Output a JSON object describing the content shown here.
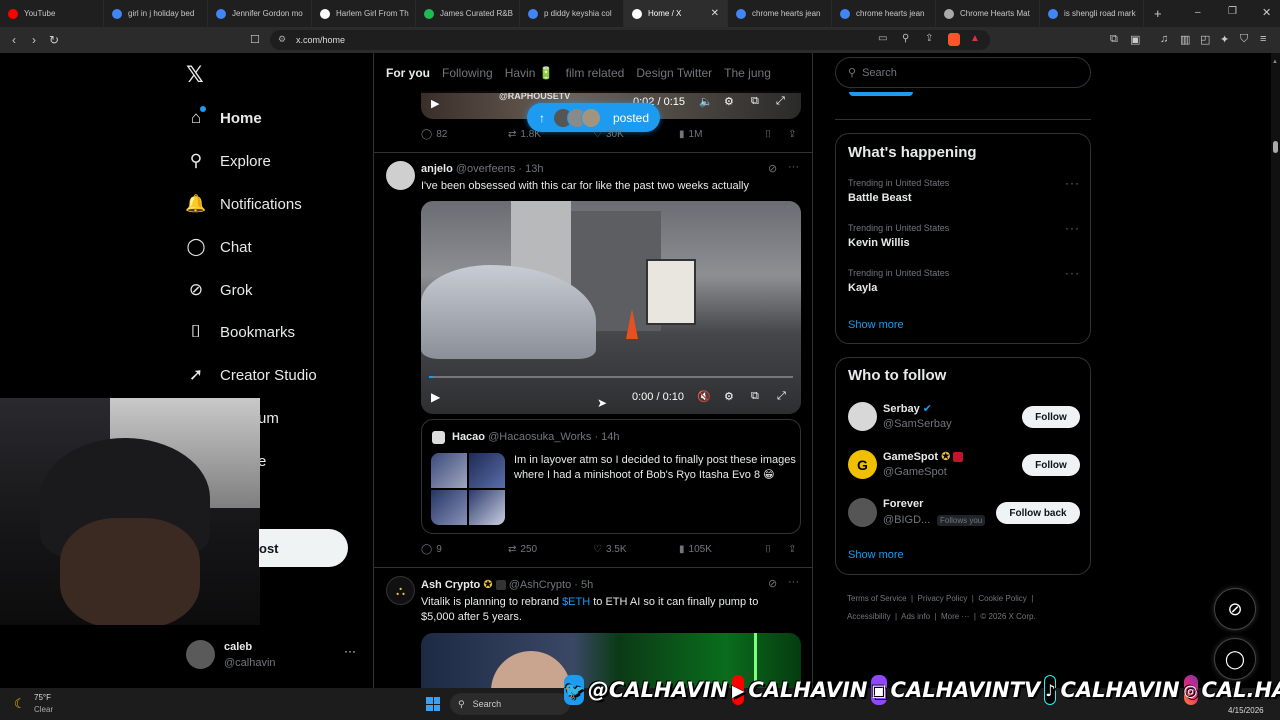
{
  "browser": {
    "tabs": [
      {
        "label": "YouTube",
        "color": "#ff0000",
        "active": false
      },
      {
        "label": "girl in j holiday bed",
        "color": "#4285f4",
        "active": false
      },
      {
        "label": "Jennifer Gordon mo",
        "color": "#4285f4",
        "active": false
      },
      {
        "label": "Harlem Girl From Th",
        "color": "#ffffff",
        "active": false
      },
      {
        "label": "James Curated R&B",
        "color": "#1db954",
        "active": false
      },
      {
        "label": "p diddy keyshia col",
        "color": "#4285f4",
        "active": false
      },
      {
        "label": "Home / X",
        "color": "#ffffff",
        "active": true
      },
      {
        "label": "chrome hearts jean",
        "color": "#4285f4",
        "active": false
      },
      {
        "label": "chrome hearts jean",
        "color": "#4285f4",
        "active": false
      },
      {
        "label": "Chrome Hearts Mat",
        "color": "#aaaaaa",
        "active": false
      },
      {
        "label": "is shengli road mark",
        "color": "#4285f4",
        "active": false
      }
    ],
    "url": "x.com/home"
  },
  "nav": {
    "items": [
      {
        "label": "Home",
        "icon": "home-icon",
        "glyph": "⌂",
        "bold": true
      },
      {
        "label": "Explore",
        "icon": "search-icon",
        "glyph": "⚲",
        "bold": false
      },
      {
        "label": "Notifications",
        "icon": "bell-icon",
        "glyph": "🔔",
        "bold": false
      },
      {
        "label": "Chat",
        "icon": "chat-icon",
        "glyph": "◯",
        "bold": false
      },
      {
        "label": "Grok",
        "icon": "grok-icon",
        "glyph": "⊘",
        "bold": false
      },
      {
        "label": "Bookmarks",
        "icon": "bookmark-icon",
        "glyph": "⌷",
        "bold": false
      },
      {
        "label": "Creator Studio",
        "icon": "rocket-icon",
        "glyph": "➚",
        "bold": false
      },
      {
        "label": "um",
        "icon": "premium-icon",
        "glyph": "",
        "bold": false
      },
      {
        "label": "e",
        "icon": "profile-icon",
        "glyph": "",
        "bold": false
      }
    ],
    "post_label": "ost",
    "account": {
      "name": "caleb",
      "handle": "@calhavin"
    }
  },
  "feed": {
    "tabs": [
      "For you",
      "Following",
      "Havin 🔋",
      "film related",
      "Design Twitter",
      "The jung"
    ],
    "top_post": {
      "time": "0:02 / 0:15",
      "watermark": "@RAPHOUSETV",
      "replies": "82",
      "reposts": "1.8K",
      "likes": "30K",
      "views": "1M",
      "posted_pill": "posted"
    },
    "post1": {
      "name": "anjelo",
      "handle": "@overfeens",
      "time": "13h",
      "text": "I've been obsessed with this car for like the past two weeks actually",
      "video_time": "0:00 / 0:10",
      "quote": {
        "name": "Hacao",
        "handle": "@Hacaosuka_Works",
        "time": "14h",
        "text": "Im in layover atm so I decided to finally post these images where I had a minishoot of Bob's Ryo Itasha Evo 8 😁"
      },
      "replies": "9",
      "reposts": "250",
      "likes": "3.5K",
      "views": "105K"
    },
    "post2": {
      "name": "Ash Crypto",
      "handle": "@AshCrypto",
      "time": "5h",
      "text_before": "Vitalik is planning to rebrand ",
      "text_link": "$ETH",
      "text_after": " to ETH AI so it can finally pump to $5,000 after 5 years."
    }
  },
  "right": {
    "search_placeholder": "Search",
    "happening": {
      "title": "What's happening",
      "trends": [
        {
          "sub": "Trending in United States",
          "name": "Battle Beast"
        },
        {
          "sub": "Trending in United States",
          "name": "Kevin Willis"
        },
        {
          "sub": "Trending in United States",
          "name": "Kayla"
        }
      ],
      "show_more": "Show more"
    },
    "who": {
      "title": "Who to follow",
      "people": [
        {
          "name": "Serbay",
          "handle": "@SamSerbay",
          "button": "Follow",
          "follows_you": ""
        },
        {
          "name": "GameSpot",
          "handle": "@GameSpot",
          "button": "Follow",
          "follows_you": ""
        },
        {
          "name": "Forever",
          "handle": "@BIGD...",
          "button": "Follow back",
          "follows_you": "Follows you"
        }
      ],
      "show_more": "Show more"
    },
    "footer": [
      "Terms of Service",
      "Privacy Policy",
      "Cookie Policy",
      "Accessibility",
      "Ads info",
      "More ···",
      "© 2026 X Corp."
    ]
  },
  "overlay": {
    "social": [
      "@CALHAVIN",
      "CALHAVIN",
      "CALHAVINTV",
      "CALHAVIN",
      "CAL.HAVIN"
    ]
  },
  "taskbar": {
    "temp": "75°F",
    "weather": "Clear",
    "search": "Search",
    "date": "4/15/2026"
  },
  "colors": {
    "accent": "#1d9bf0",
    "bg": "#000000",
    "border": "#2f3336",
    "muted": "#71767b"
  }
}
